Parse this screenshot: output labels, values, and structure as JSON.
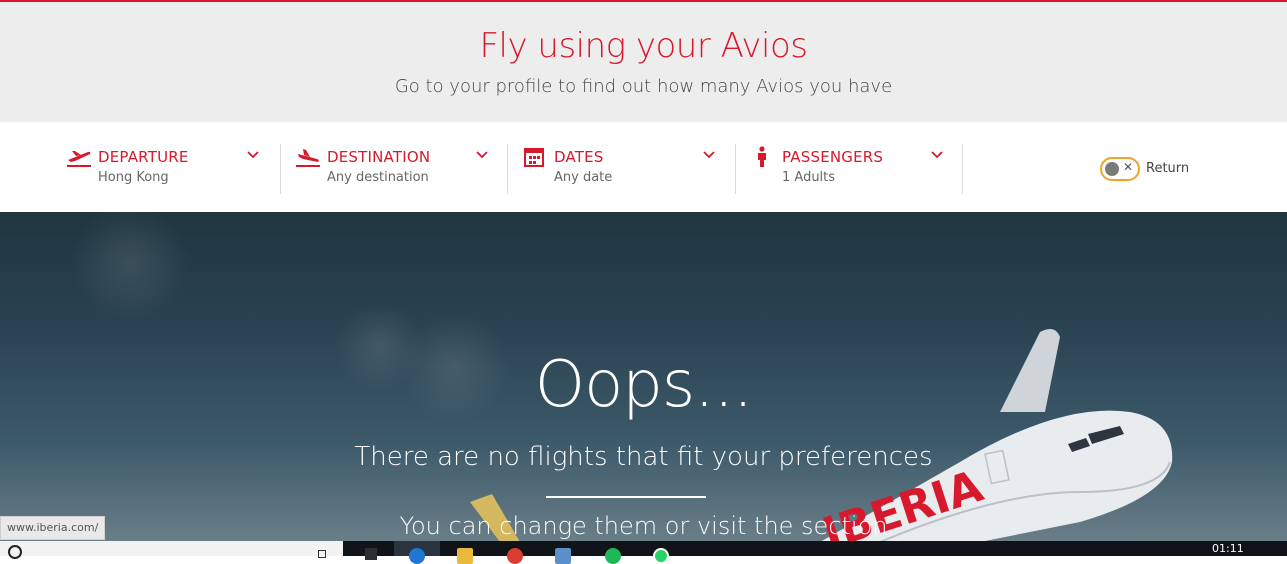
{
  "header": {
    "title": "Fly using your Avios",
    "subtitle": "Go to your profile to find out how many Avios you have"
  },
  "search": {
    "fields": [
      {
        "label": "DEPARTURE",
        "value": "Hong Kong",
        "icon": "plane-takeoff-icon"
      },
      {
        "label": "DESTINATION",
        "value": "Any destination",
        "icon": "plane-landing-icon"
      },
      {
        "label": "DATES",
        "value": "Any date",
        "icon": "calendar-icon"
      },
      {
        "label": "PASSENGERS",
        "value": "1 Adults",
        "icon": "person-icon"
      }
    ],
    "return_label": "Return",
    "return_enabled": false
  },
  "hero": {
    "title": "Oops...",
    "message": "There are no flights that fit your preferences",
    "message2": "You can change them or visit the section",
    "plane_livery": "IBERIA"
  },
  "status_url": "www.iberia.com/",
  "taskbar": {
    "clock": "01:11"
  },
  "colors": {
    "brand_red": "#d7192d",
    "toggle_orange": "#f0a22a",
    "header_bg": "#ededed"
  }
}
